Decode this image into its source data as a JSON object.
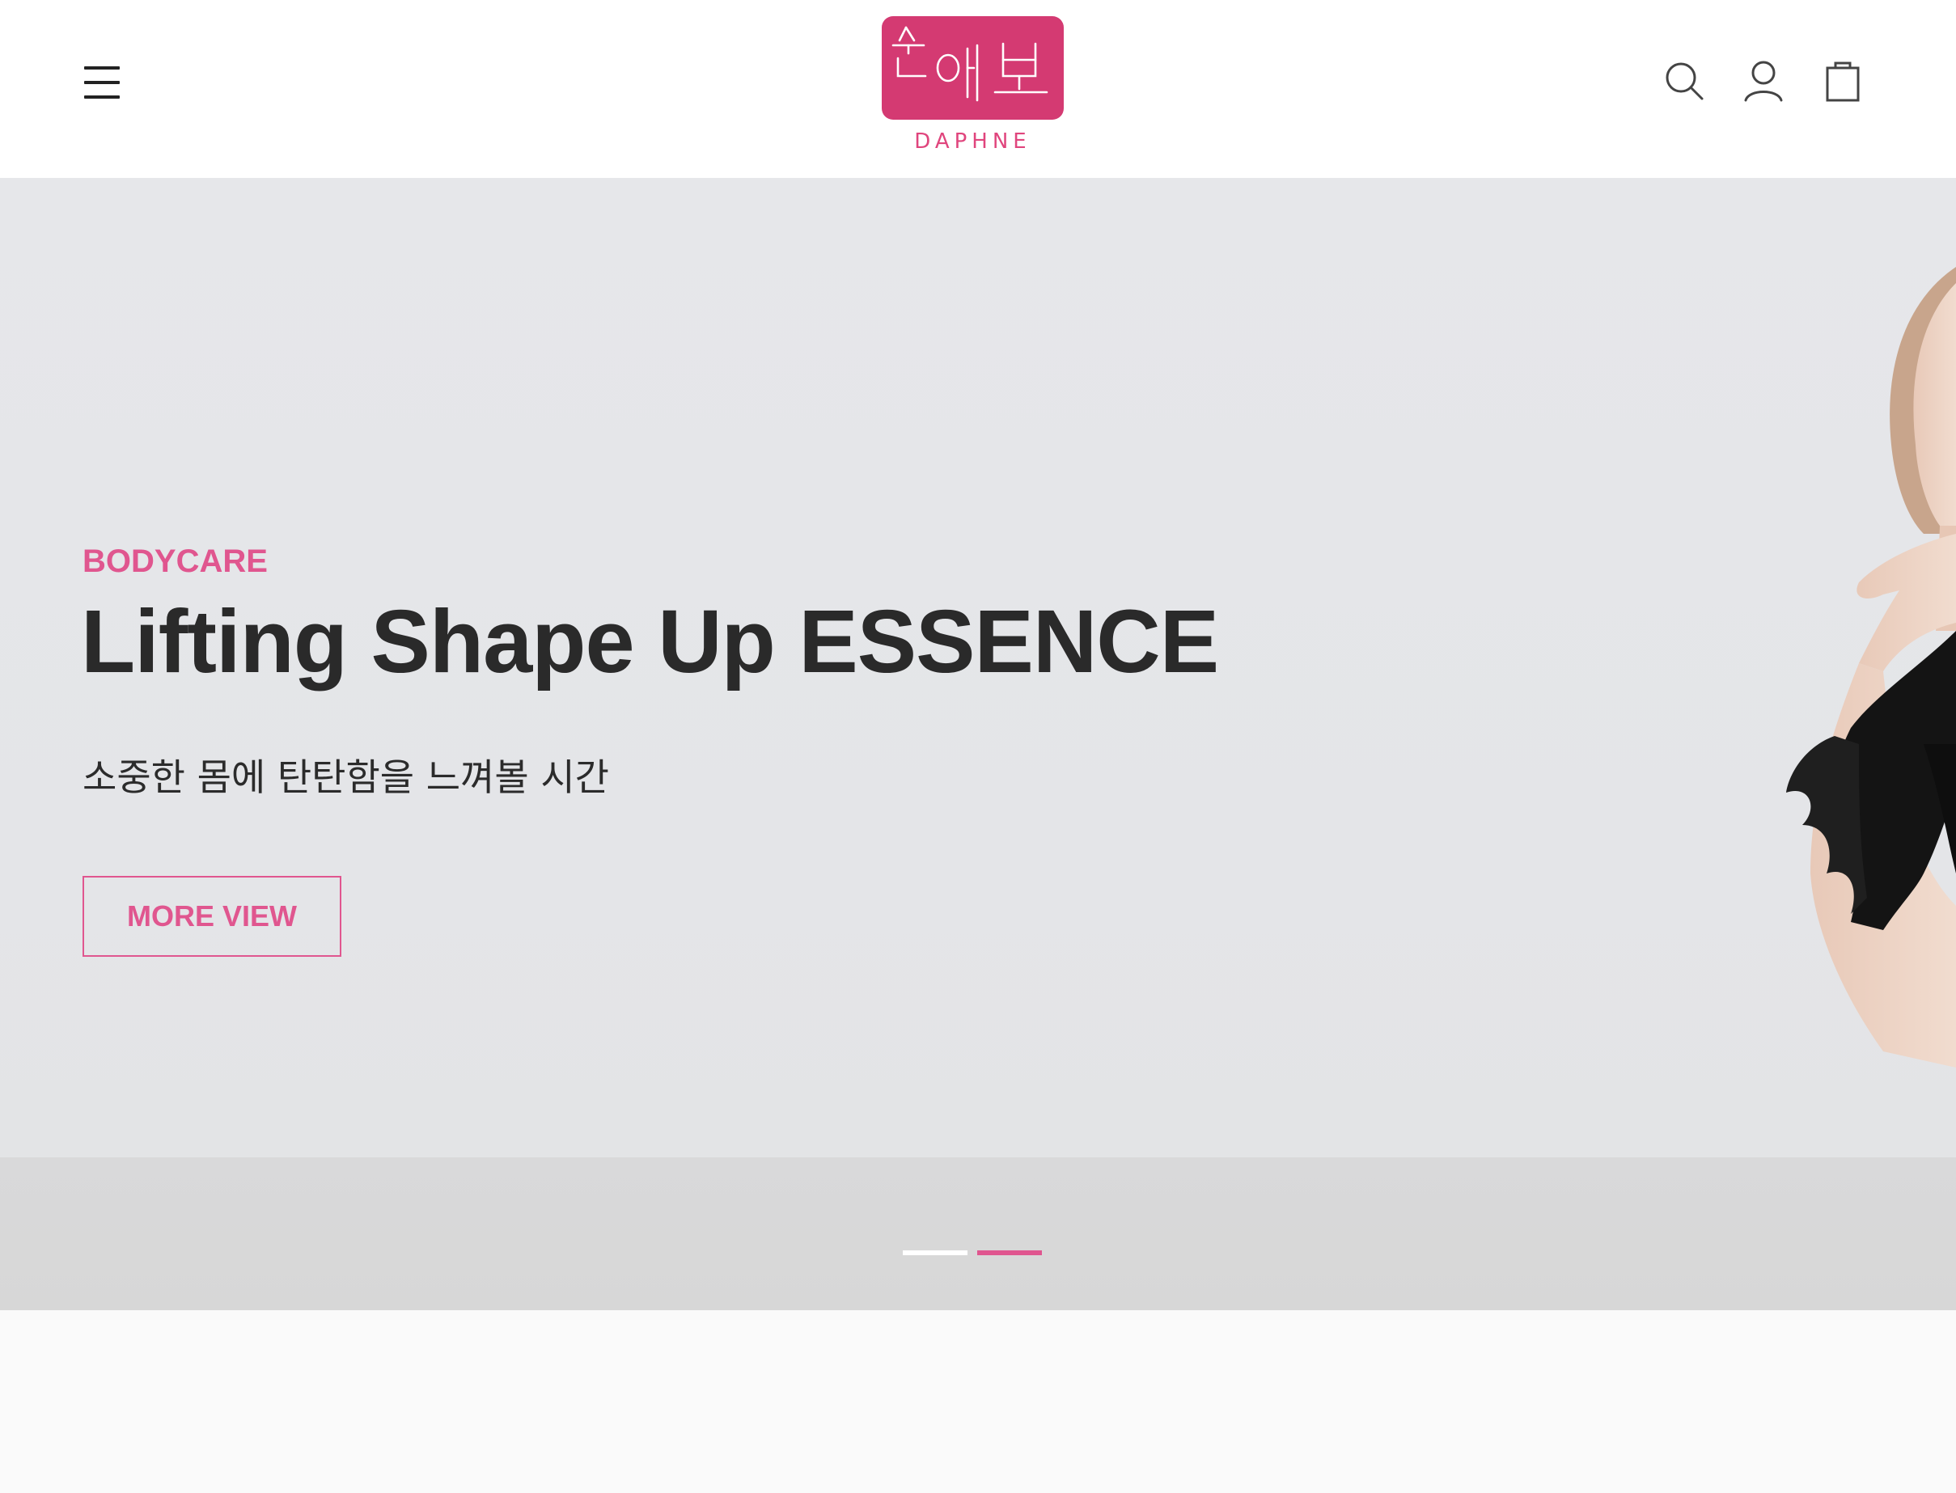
{
  "header": {
    "logo_korean": "순애보",
    "logo_brand": "DAPHNE",
    "icons": [
      "menu-icon",
      "search-icon",
      "user-icon",
      "shopping-bag-icon"
    ]
  },
  "hero": {
    "eyebrow": "BODYCARE",
    "title": "Lifting Shape Up ESSENCE",
    "subtitle": "소중한 몸에 탄탄함을 느껴볼 시간",
    "cta_label": "MORE VIEW",
    "slides_total": 2,
    "active_slide": 2
  },
  "colors": {
    "accent": "#e0568f",
    "logo_bg": "#d43a72",
    "text_dark": "#2a2a2a",
    "hero_bg": "#e5e6e9"
  }
}
